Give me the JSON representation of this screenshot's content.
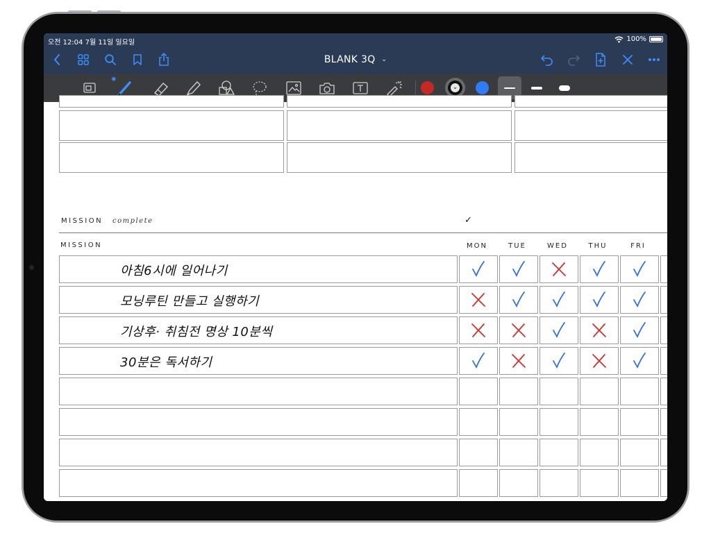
{
  "status": {
    "time": "오전 12:04   7월 11일 일요일",
    "battery": "100%"
  },
  "nav": {
    "title": "BLANK 3Q",
    "icons_left": [
      "back-icon",
      "grid-icon",
      "search-icon",
      "bookmark-icon",
      "share-icon"
    ],
    "icons_right": [
      "undo-icon",
      "redo-icon",
      "add-page-icon",
      "close-icon",
      "more-icon"
    ]
  },
  "toolbar": {
    "tools": [
      "zoom-window-icon",
      "pen-icon",
      "eraser-icon",
      "highlighter-icon",
      "shapes-icon",
      "lasso-icon",
      "image-icon",
      "camera-icon",
      "text-icon",
      "laser-pointer-icon"
    ],
    "colors": [
      "#c62828",
      "#111111",
      "#2f7cf6"
    ],
    "stroke_widths": [
      "thin",
      "medium",
      "thick"
    ],
    "selected_stroke": "thin"
  },
  "page": {
    "mission_header": "MISSION",
    "complete_word": "complete",
    "complete_check": "✓",
    "table_header": "MISSION",
    "days": [
      "MON",
      "TUE",
      "WED",
      "THU",
      "FRI"
    ],
    "missions": [
      {
        "text": "아침6시에 일어나기",
        "marks": [
          "check",
          "check",
          "x",
          "check",
          "check"
        ]
      },
      {
        "text": "모닝루틴 만들고 실행하기",
        "marks": [
          "x",
          "check",
          "check",
          "check",
          "check"
        ]
      },
      {
        "text": "기상후· 취침전 명상 10분씩",
        "marks": [
          "x",
          "x",
          "check",
          "x",
          "check"
        ]
      },
      {
        "text": "30분은 독서하기",
        "marks": [
          "check",
          "x",
          "check",
          "x",
          "check"
        ]
      },
      {
        "text": "",
        "marks": [
          "",
          "",
          "",
          "",
          ""
        ]
      },
      {
        "text": "",
        "marks": [
          "",
          "",
          "",
          "",
          ""
        ]
      },
      {
        "text": "",
        "marks": [
          "",
          "",
          "",
          "",
          ""
        ]
      },
      {
        "text": "",
        "marks": [
          "",
          "",
          "",
          "",
          ""
        ]
      }
    ],
    "mark_colors": {
      "check": "#2f6fe0",
      "x": "#d0312d"
    }
  }
}
